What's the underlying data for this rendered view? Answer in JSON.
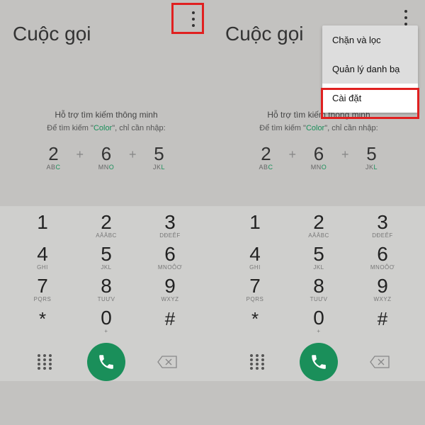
{
  "left": {
    "title": "Cuộc gọi",
    "hint1": "Hỗ trợ tìm kiếm thông minh",
    "hint2a": "Để tìm kiếm \"",
    "hint2b": "Color",
    "hint2c": "\", chỉ cần nhập:",
    "ex": [
      {
        "n": "2",
        "s": "AB",
        "h": "C"
      },
      {
        "n": "6",
        "s": "MN",
        "h": "O"
      },
      {
        "n": "5",
        "s": "JK",
        "h": "L"
      }
    ]
  },
  "right": {
    "title": "Cuộc gọi",
    "hint1": "Hỗ trợ tìm kiếm thông minh",
    "hint2a": "Để tìm kiếm \"",
    "hint2b": "Color",
    "hint2c": "\", chỉ cần nhập:",
    "menu": {
      "block": "Chặn và lọc",
      "contacts": "Quản lý danh bạ",
      "settings": "Cài đặt"
    }
  },
  "keys": {
    "r1": [
      {
        "n": "1",
        "s": ""
      },
      {
        "n": "2",
        "s": "AĂÂBC"
      },
      {
        "n": "3",
        "s": "DĐEÊF"
      }
    ],
    "r2": [
      {
        "n": "4",
        "s": "GHI"
      },
      {
        "n": "5",
        "s": "JKL"
      },
      {
        "n": "6",
        "s": "MNOÔƠ"
      }
    ],
    "r3": [
      {
        "n": "7",
        "s": "PQRS"
      },
      {
        "n": "8",
        "s": "TUƯV"
      },
      {
        "n": "9",
        "s": "WXYZ"
      }
    ],
    "r4": [
      {
        "n": "*",
        "s": ""
      },
      {
        "n": "0",
        "s": "+"
      },
      {
        "n": "#",
        "s": ""
      }
    ]
  }
}
